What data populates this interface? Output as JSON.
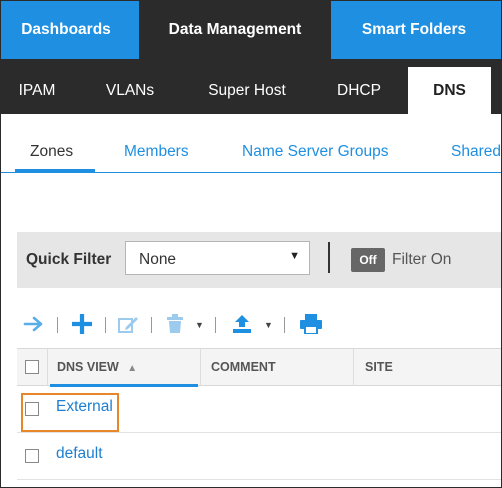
{
  "top_tabs": [
    {
      "label": "Dashboards",
      "active": false
    },
    {
      "label": "Data Management",
      "active": true
    },
    {
      "label": "Smart Folders",
      "active": false
    }
  ],
  "sub_tabs": [
    {
      "label": "IPAM",
      "active": false
    },
    {
      "label": "VLANs",
      "active": false
    },
    {
      "label": "Super Host",
      "active": false
    },
    {
      "label": "DHCP",
      "active": false
    },
    {
      "label": "DNS",
      "active": true
    }
  ],
  "third_tabs": [
    {
      "label": "Zones",
      "active": true
    },
    {
      "label": "Members",
      "active": false
    },
    {
      "label": "Name Server Groups",
      "active": false
    },
    {
      "label": "Shared",
      "active": false
    }
  ],
  "quick_filter": {
    "label": "Quick Filter",
    "selected": "None",
    "toggle_label": "Off",
    "filter_on_label": "Filter On"
  },
  "toolbar": {
    "icons": [
      "arrow-right-icon",
      "add-icon",
      "edit-icon",
      "delete-icon",
      "export-icon",
      "print-icon"
    ]
  },
  "grid": {
    "columns": [
      "DNS VIEW",
      "COMMENT",
      "SITE"
    ],
    "sort_indicator": "▲",
    "rows": [
      {
        "name": "External",
        "highlighted": true
      },
      {
        "name": "default",
        "highlighted": false
      }
    ]
  },
  "colors": {
    "accent": "#1e8fe1",
    "dark": "#2b2b2b",
    "highlight": "#e8862a"
  }
}
